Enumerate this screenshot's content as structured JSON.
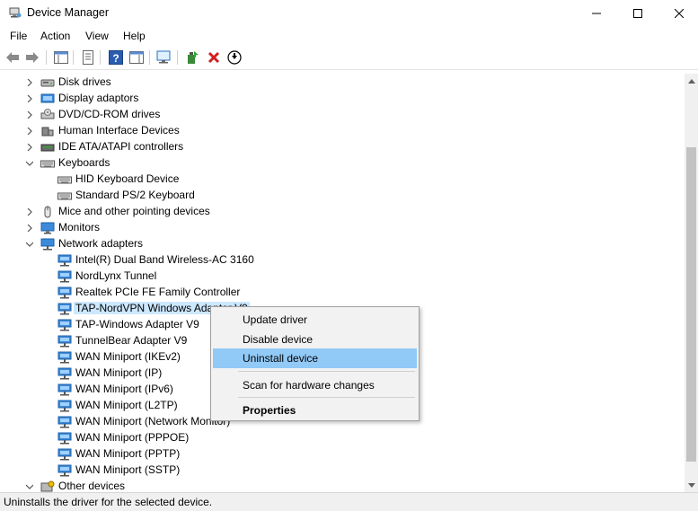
{
  "window": {
    "title": "Device Manager"
  },
  "menu": [
    "File",
    "Action",
    "View",
    "Help"
  ],
  "tree": {
    "rows": [
      {
        "label": "Disk drives",
        "level": 0,
        "expanded": false,
        "icon": "disk-icon"
      },
      {
        "label": "Display adaptors",
        "level": 0,
        "expanded": false,
        "icon": "display-adapter-icon"
      },
      {
        "label": "DVD/CD-ROM drives",
        "level": 0,
        "expanded": false,
        "icon": "dvd-icon"
      },
      {
        "label": "Human Interface Devices",
        "level": 0,
        "expanded": false,
        "icon": "hid-icon"
      },
      {
        "label": "IDE ATA/ATAPI controllers",
        "level": 0,
        "expanded": false,
        "icon": "ide-icon"
      },
      {
        "label": "Keyboards",
        "level": 0,
        "expanded": true,
        "icon": "keyboard-icon"
      },
      {
        "label": "HID Keyboard Device",
        "level": 1,
        "icon": "keyboard-icon"
      },
      {
        "label": "Standard PS/2 Keyboard",
        "level": 1,
        "icon": "keyboard-icon"
      },
      {
        "label": "Mice and other pointing devices",
        "level": 0,
        "expanded": false,
        "icon": "mouse-icon"
      },
      {
        "label": "Monitors",
        "level": 0,
        "expanded": false,
        "icon": "monitor-icon"
      },
      {
        "label": "Network adapters",
        "level": 0,
        "expanded": true,
        "icon": "network-icon"
      },
      {
        "label": "Intel(R) Dual Band Wireless-AC 3160",
        "level": 1,
        "icon": "network-adapter-icon"
      },
      {
        "label": "NordLynx Tunnel",
        "level": 1,
        "icon": "network-adapter-icon"
      },
      {
        "label": "Realtek PCIe FE Family Controller",
        "level": 1,
        "icon": "network-adapter-icon"
      },
      {
        "label": "TAP-NordVPN Windows Adapter V9",
        "level": 1,
        "icon": "network-adapter-icon",
        "selected": true
      },
      {
        "label": "TAP-Windows Adapter V9",
        "level": 1,
        "icon": "network-adapter-icon"
      },
      {
        "label": "TunnelBear Adapter V9",
        "level": 1,
        "icon": "network-adapter-icon"
      },
      {
        "label": "WAN Miniport (IKEv2)",
        "level": 1,
        "icon": "network-adapter-icon"
      },
      {
        "label": "WAN Miniport (IP)",
        "level": 1,
        "icon": "network-adapter-icon"
      },
      {
        "label": "WAN Miniport (IPv6)",
        "level": 1,
        "icon": "network-adapter-icon"
      },
      {
        "label": "WAN Miniport (L2TP)",
        "level": 1,
        "icon": "network-adapter-icon"
      },
      {
        "label": "WAN Miniport (Network Monitor)",
        "level": 1,
        "icon": "network-adapter-icon"
      },
      {
        "label": "WAN Miniport (PPPOE)",
        "level": 1,
        "icon": "network-adapter-icon"
      },
      {
        "label": "WAN Miniport (PPTP)",
        "level": 1,
        "icon": "network-adapter-icon"
      },
      {
        "label": "WAN Miniport (SSTP)",
        "level": 1,
        "icon": "network-adapter-icon"
      },
      {
        "label": "Other devices",
        "level": 0,
        "expanded": true,
        "icon": "other-devices-icon"
      }
    ]
  },
  "context_menu": {
    "items": [
      {
        "label": "Update driver"
      },
      {
        "label": "Disable device"
      },
      {
        "label": "Uninstall device",
        "highlighted": true
      },
      {
        "label": "Scan for hardware changes"
      },
      {
        "label": "Properties",
        "bold": true
      }
    ]
  },
  "status": {
    "text": "Uninstalls the driver for the selected device."
  },
  "colors": {
    "selection": "#cce8ff",
    "menu_highlight": "#91c9f7",
    "icon_blue": "#1f6fc7",
    "delete_red": "#d0201f"
  }
}
